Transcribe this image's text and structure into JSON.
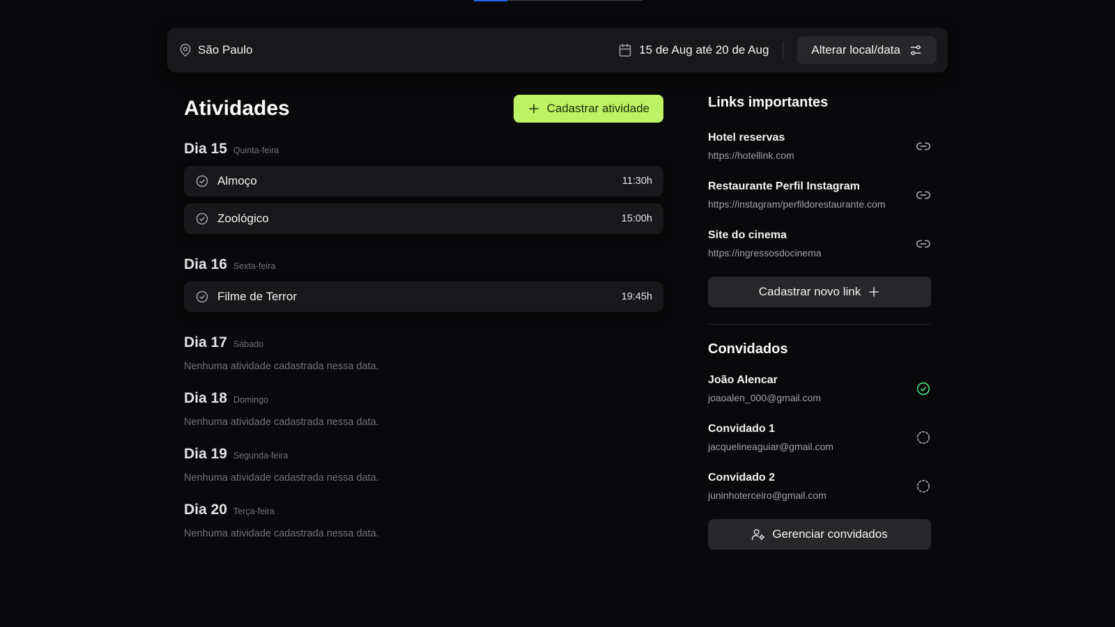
{
  "header": {
    "location": "São Paulo",
    "dates": "15 de Aug até 20 de Aug",
    "change_button": "Alterar local/data"
  },
  "activities": {
    "title": "Atividades",
    "add_button": "Cadastrar atividade",
    "days": [
      {
        "title": "Dia 15",
        "weekday": "Quinta-feira",
        "items": [
          {
            "name": "Almoço",
            "time": "11:30h"
          },
          {
            "name": "Zoológico",
            "time": "15:00h"
          }
        ]
      },
      {
        "title": "Dia 16",
        "weekday": "Sexta-feira",
        "items": [
          {
            "name": "Filme de Terror",
            "time": "19:45h"
          }
        ]
      },
      {
        "title": "Dia 17",
        "weekday": "Sábado",
        "empty": "Nenhuma atividade cadastrada nessa data."
      },
      {
        "title": "Dia 18",
        "weekday": "Domingo",
        "empty": "Nenhuma atividade cadastrada nessa data."
      },
      {
        "title": "Dia 19",
        "weekday": "Segunda-feira",
        "empty": "Nenhuma atividade cadastrada nessa data."
      },
      {
        "title": "Dia 20",
        "weekday": "Terça-feira",
        "empty": "Nenhuma atividade cadastrada nessa data."
      }
    ]
  },
  "links": {
    "title": "Links importantes",
    "items": [
      {
        "title": "Hotel reservas",
        "url": "https://hotellink.com"
      },
      {
        "title": "Restaurante Perfil Instagram",
        "url": "https://instagram/perfildorestaurante.com"
      },
      {
        "title": "Site do cinema",
        "url": "https://ingressosdocinema"
      }
    ],
    "add_button": "Cadastrar novo link"
  },
  "guests": {
    "title": "Convidados",
    "items": [
      {
        "name": "João Alencar",
        "email": "joaoalen_000@gmail.com",
        "status": "confirmed"
      },
      {
        "name": "Convidado 1",
        "email": "jacquelineaguiar@gmail.com",
        "status": "pending"
      },
      {
        "name": "Convidado 2",
        "email": "juninhoterceiro@gmail.com",
        "status": "pending"
      }
    ],
    "manage_button": "Gerenciar convidados"
  },
  "colors": {
    "background": "#09090b",
    "card": "#18181b",
    "accent": "#bef264",
    "confirmed": "#4ade80",
    "muted": "#71717a"
  },
  "icons": {
    "location": "map-pin-icon",
    "calendar": "calendar-icon",
    "settings": "settings-sliders-icon",
    "plus": "plus-icon",
    "check": "circle-check-icon",
    "link": "link-icon",
    "pending": "circle-dashed-icon",
    "user": "user-cog-icon"
  }
}
